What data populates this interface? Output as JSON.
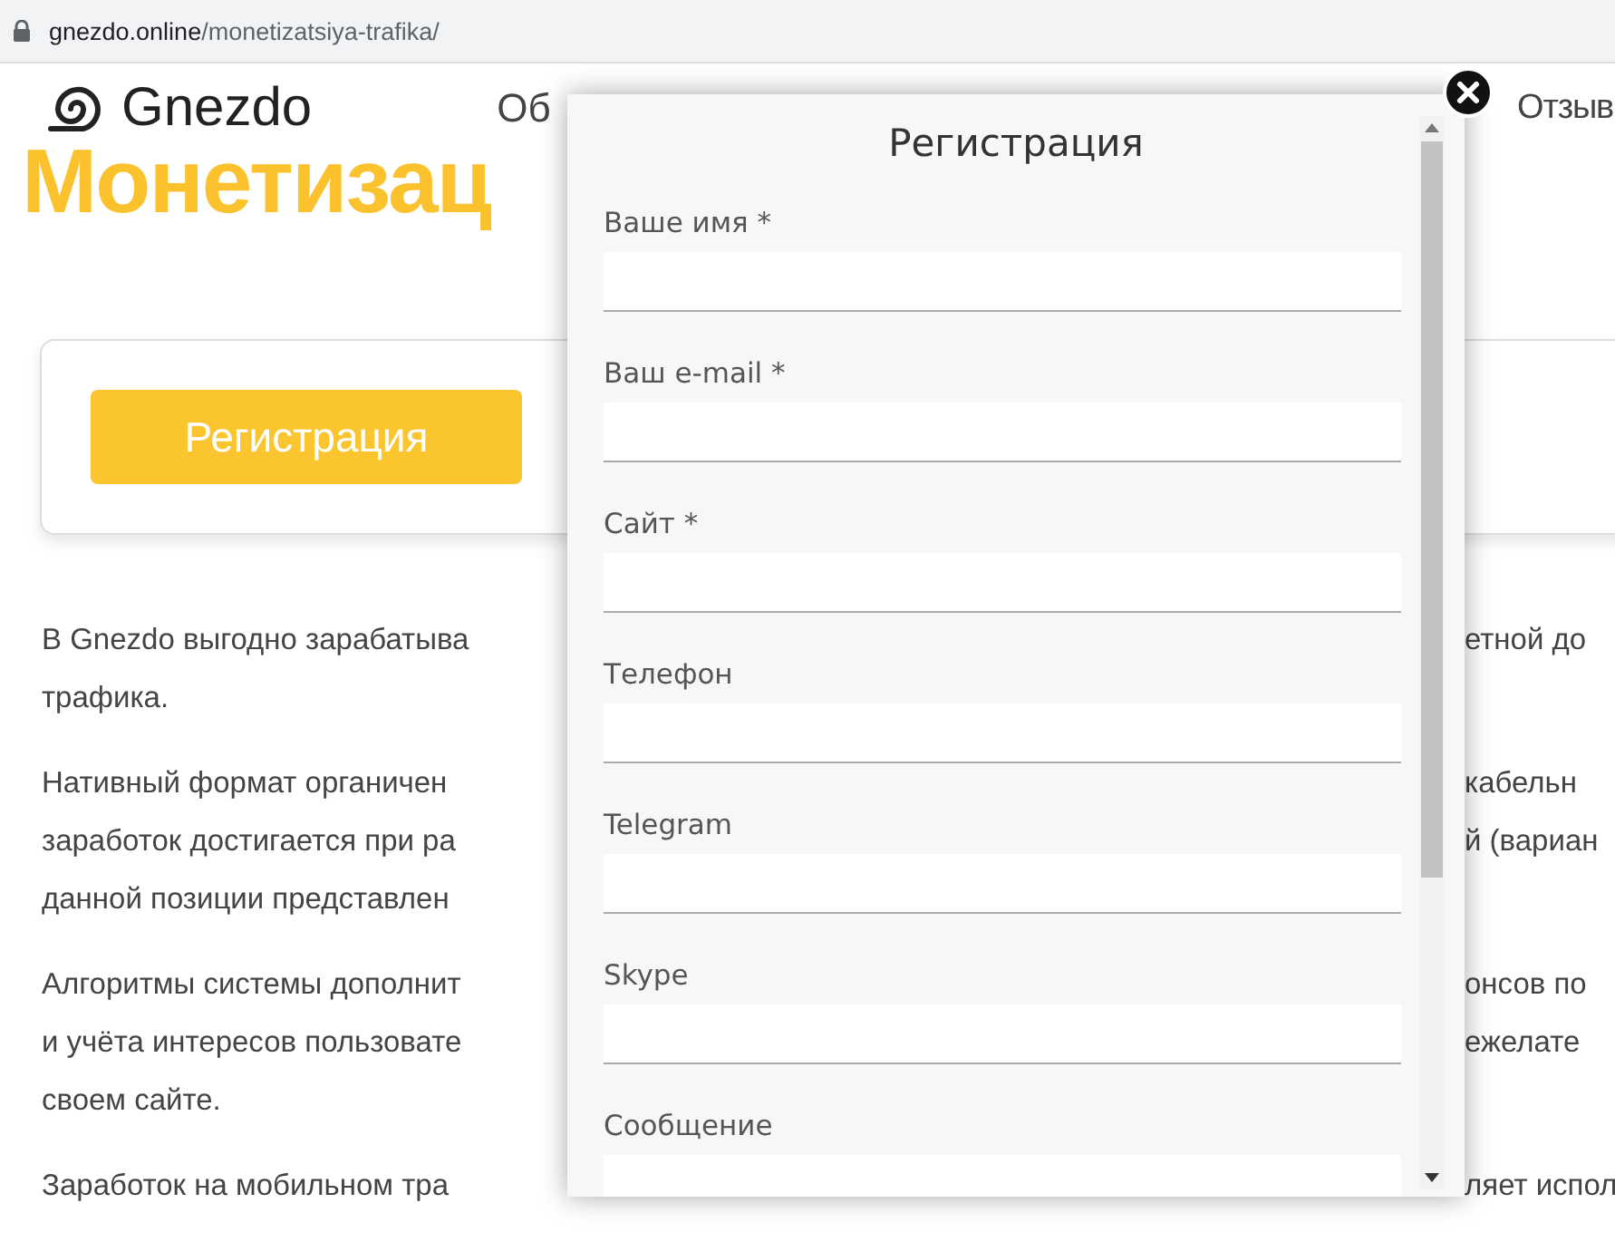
{
  "address_bar": {
    "domain": "gnezdo.online",
    "path": "/monetizatsiya-trafika/"
  },
  "header": {
    "logo": "Gnezdo",
    "nav": [
      "Об",
      "Отзыв"
    ]
  },
  "heading": "Монетизац",
  "card": {
    "button": "Регистрация"
  },
  "paragraphs": [
    {
      "lines": [
        {
          "left": "В Gnezdo выгодно зарабатыва",
          "right": "етной до"
        },
        {
          "left": "трафика."
        }
      ]
    },
    {
      "lines": [
        {
          "left": "Нативный формат органичен",
          "right": "кабельн"
        },
        {
          "left": "заработок достигается при ра",
          "right": "й (вариан"
        },
        {
          "left": "данной позиции представлен"
        }
      ]
    },
    {
      "lines": [
        {
          "left": "Алгоритмы системы дополнит",
          "right": "онсов по"
        },
        {
          "left": "и учёта интересов пользовате",
          "right": "ежелате"
        },
        {
          "left": "своем сайте."
        }
      ]
    },
    {
      "lines": [
        {
          "left": "Заработок на мобильном тра",
          "right": "ляет испол"
        }
      ]
    }
  ],
  "modal": {
    "title": "Регистрация",
    "fields": [
      {
        "label": "Ваше имя *"
      },
      {
        "label": "Ваш e-mail *"
      },
      {
        "label": "Сайт *"
      },
      {
        "label": "Телефон"
      },
      {
        "label": "Telegram"
      },
      {
        "label": "Skype"
      },
      {
        "label": "Сообщение"
      }
    ]
  }
}
